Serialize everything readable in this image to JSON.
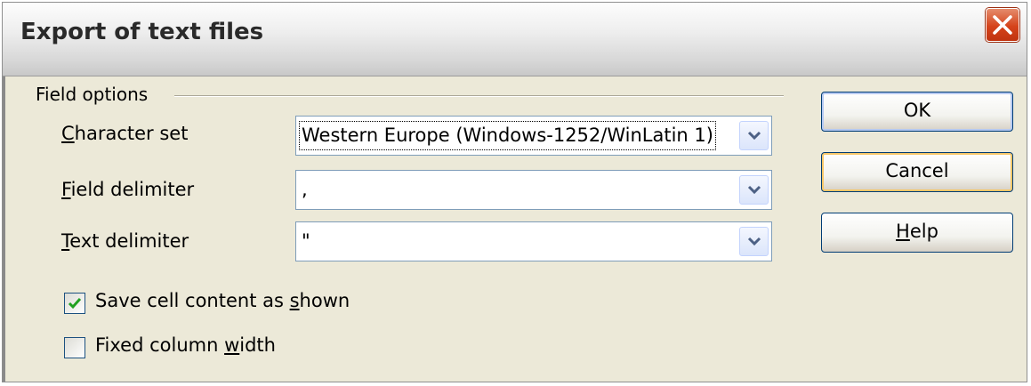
{
  "window": {
    "title": "Export of text files"
  },
  "group": {
    "label": "Field options"
  },
  "fields": [
    {
      "label_pre": "",
      "label_key": "C",
      "label_post": "haracter set",
      "value": "Western Europe (Windows-1252/WinLatin 1)"
    },
    {
      "label_pre": "",
      "label_key": "F",
      "label_post": "ield delimiter",
      "value": ","
    },
    {
      "label_pre": "",
      "label_key": "T",
      "label_post": "ext delimiter",
      "value": "\""
    }
  ],
  "checkboxes": [
    {
      "label_pre": "Save cell content as ",
      "label_key": "s",
      "label_post": "hown",
      "checked": true
    },
    {
      "label_pre": "Fixed column ",
      "label_key": "w",
      "label_post": "idth",
      "checked": false
    }
  ],
  "buttons": {
    "ok": {
      "label": "OK"
    },
    "cancel": {
      "label": "Cancel"
    },
    "help": {
      "label_key": "H",
      "label_post": "elp"
    }
  }
}
